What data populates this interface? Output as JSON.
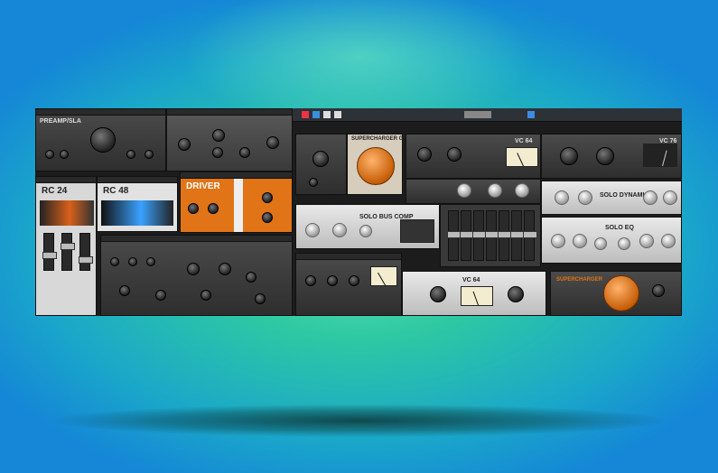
{
  "plugins": {
    "fat_channel": {
      "title": "PREAMP/SLA"
    },
    "rc24_a": {
      "name": "RC 24"
    },
    "rc48": {
      "name": "RC 48"
    },
    "driver": {
      "name": "DRIVER"
    },
    "supercharger_gt": {
      "name": "SUPERCHARGER GT"
    },
    "vc64": {
      "name": "VC 64"
    },
    "vc76": {
      "name": "VC 76"
    },
    "solo_bus_comp": {
      "name": "SOLO BUS COMP"
    },
    "solo_dynamics": {
      "name": "SOLO DYNAMICS"
    },
    "solo_eq": {
      "name": "SOLO EQ"
    },
    "vc64_b": {
      "name": "VC 64"
    },
    "supercharger_b": {
      "name": "SUPERCHARGER"
    }
  },
  "colors": {
    "background_center": "#6fe3b8",
    "background_edge": "#1587d6",
    "accent_orange": "#e07417",
    "rc_blue": "#3aa2ff"
  },
  "icons": [
    "knob-icon",
    "fader-icon",
    "vu-meter-icon"
  ]
}
